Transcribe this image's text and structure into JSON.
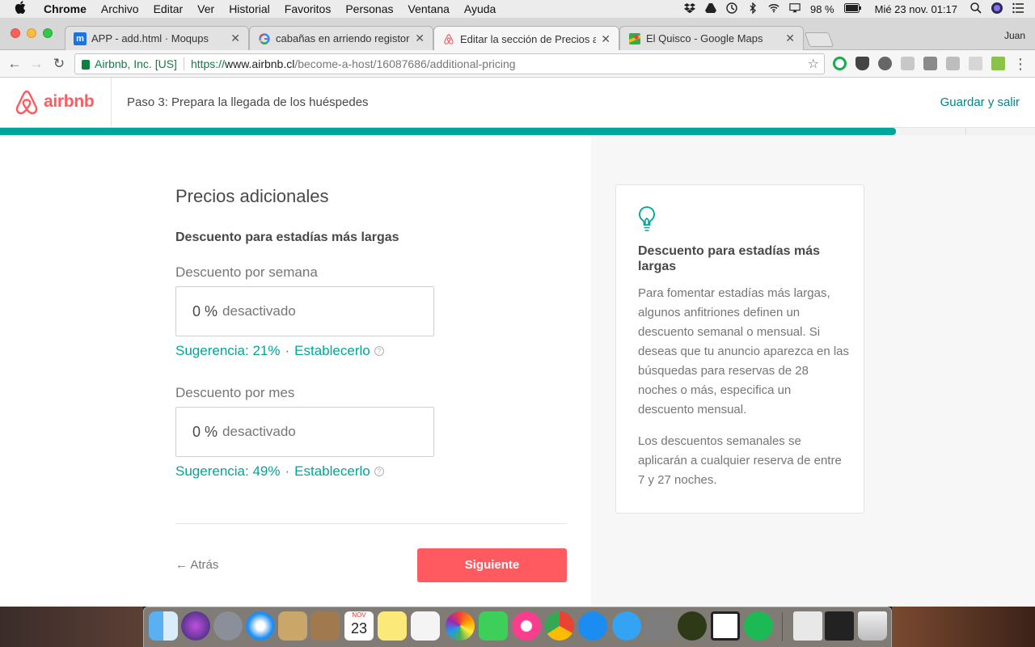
{
  "menubar": {
    "app": "Chrome",
    "items": [
      "Archivo",
      "Editar",
      "Ver",
      "Historial",
      "Favoritos",
      "Personas",
      "Ventana",
      "Ayuda"
    ],
    "battery": "98 %",
    "datetime": "Mié 23 nov.  01:17"
  },
  "tabs": [
    {
      "title": "APP - add.html · Moqups",
      "icon": "moqups-icon"
    },
    {
      "title": "cabañas en arriendo registor -",
      "icon": "google-icon"
    },
    {
      "title": "Editar la sección de Precios ad",
      "icon": "airbnb-icon"
    },
    {
      "title": "El Quisco - Google Maps",
      "icon": "maps-icon"
    }
  ],
  "profile_name": "Juan",
  "omnibox": {
    "secure_label": "Airbnb, Inc. [US]",
    "scheme": "https://",
    "host": "www.airbnb.cl",
    "path": "/become-a-host/16087686/additional-pricing"
  },
  "header": {
    "logo_text": "airbnb",
    "step_text": "Paso 3: Prepara la llegada de los huéspedes",
    "save_exit": "Guardar y salir",
    "progress": 0.866
  },
  "form": {
    "title": "Precios adicionales",
    "section_title": "Descuento para estadías más largas",
    "weekly": {
      "label": "Descuento por semana",
      "value": "0",
      "unit": "%",
      "placeholder": "desactivado",
      "suggestion": "Sugerencia: 21%",
      "set_link": "Establecerlo"
    },
    "monthly": {
      "label": "Descuento por mes",
      "value": "0",
      "unit": "%",
      "placeholder": "desactivado",
      "suggestion": "Sugerencia: 49%",
      "set_link": "Establecerlo"
    },
    "back_label": "← Atrás",
    "next_label": "Siguiente"
  },
  "tip": {
    "title": "Descuento para estadías más largas",
    "paragraph1": "Para fomentar estadías más largas, algunos anfitriones definen un descuento semanal o mensual. Si deseas que tu anuncio aparezca en las búsquedas para reservas de 28 noches o más, especifica un descuento mensual.",
    "paragraph2": "Los descuentos semanales se aplicarán a cualquier reserva de entre 7 y 27 noches."
  },
  "colors": {
    "brand": "#ff5a5f",
    "teal": "#00a699"
  },
  "dock": {
    "calendar_month": "NOV",
    "calendar_day": "23"
  }
}
